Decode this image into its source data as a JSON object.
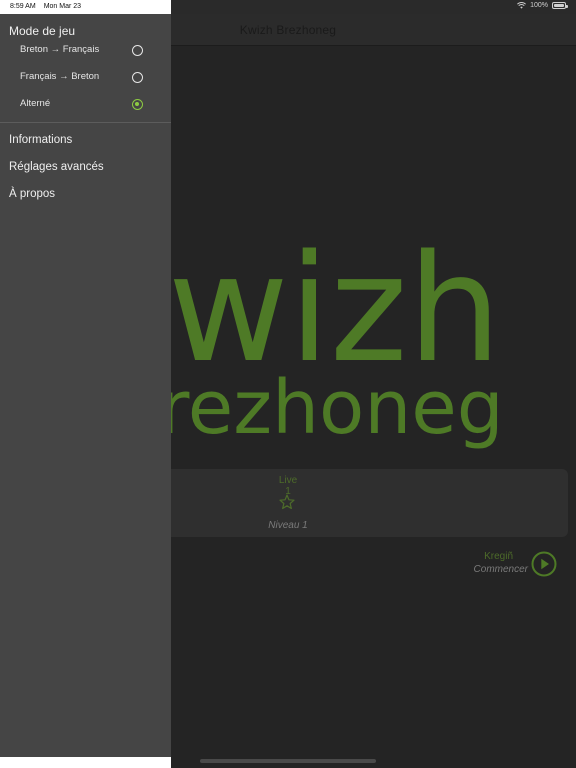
{
  "status_bar": {
    "time": "8:59 AM",
    "date": "Mon Mar 23",
    "battery": "100%"
  },
  "navbar": {
    "title": "Kwizh Brezhoneg"
  },
  "logo": {
    "line1": "kwizh",
    "line2": "brezhoneg",
    "color": "#4e7a26"
  },
  "level_card": {
    "name": "Live 1",
    "level": "Niveau 1",
    "stars_filled": 0,
    "stars_total": 1
  },
  "start": {
    "label_breton": "Kregiñ",
    "label_french": "Commencer"
  },
  "drawer": {
    "section_title": "Mode de jeu",
    "modes": [
      {
        "label": "Breton → Français",
        "selected": false
      },
      {
        "label": "Français → Breton",
        "selected": false
      },
      {
        "label": "Alterné",
        "selected": true
      }
    ],
    "menu": [
      {
        "label": "Informations"
      },
      {
        "label": "Réglages avancés"
      },
      {
        "label": "À propos"
      }
    ]
  },
  "colors": {
    "accent": "#8dcb42",
    "drawer_bg": "#454545",
    "main_bg": "#242424"
  }
}
